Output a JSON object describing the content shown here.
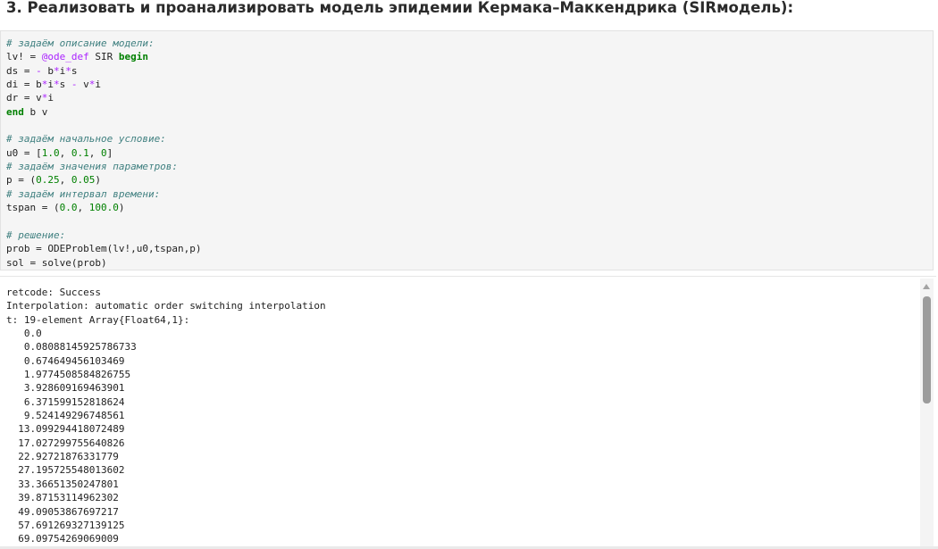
{
  "heading": "3. Реализовать и проанализировать модель эпидемии Кермака–Маккендрика (SIRмодель):",
  "code": {
    "comment_model": "# задаём описание модели:",
    "line_lv_pre": "lv! = ",
    "line_lv_macro": "@ode_def",
    "line_lv_mid": " SIR ",
    "line_lv_kw": "begin",
    "line_ds_pre": "ds = ",
    "line_ds_op1": "-",
    "line_ds_mid": " b",
    "line_ds_op2": "*",
    "line_ds_mid2": "i",
    "line_ds_op3": "*",
    "line_ds_end": "s",
    "line_di_pre": "di = b",
    "line_di_op1": "*",
    "line_di_mid": "i",
    "line_di_op2": "*",
    "line_di_mid2": "s ",
    "line_di_op3": "-",
    "line_di_mid3": " v",
    "line_di_op4": "*",
    "line_di_end": "i",
    "line_dr_pre": "dr = v",
    "line_dr_op": "*",
    "line_dr_end": "i",
    "line_end_kw": "end",
    "line_end_rest": " b v",
    "comment_initial": "# задаём начальное условие:",
    "line_u0_pre": "u0 = [",
    "line_u0_n1": "1.0",
    "line_u0_sep1": ", ",
    "line_u0_n2": "0.1",
    "line_u0_sep2": ", ",
    "line_u0_n3": "0",
    "line_u0_end": "]",
    "comment_params": "# задаём значения параметров:",
    "line_p_pre": "p = (",
    "line_p_n1": "0.25",
    "line_p_sep": ", ",
    "line_p_n2": "0.05",
    "line_p_end": ")",
    "comment_tspan": "# задаём интервал времени:",
    "line_tspan_pre": "tspan = (",
    "line_tspan_n1": "0.0",
    "line_tspan_sep": ", ",
    "line_tspan_n2": "100.0",
    "line_tspan_end": ")",
    "comment_solve": "# решение:",
    "line_prob": "prob = ODEProblem(lv!,u0,tspan,p)",
    "line_sol": "sol = solve(prob)"
  },
  "output": {
    "retcode": "retcode: Success",
    "interpolation": "Interpolation: automatic order switching interpolation",
    "t_header": "t: 19-element Array{Float64,1}:",
    "t_values": [
      "   0.0",
      "   0.08088145925786733",
      "   0.674649456103469",
      "   1.9774508584826755",
      "   3.928609169463901",
      "   6.371599152818624",
      "   9.524149296748561",
      "  13.099294418072489",
      "  17.027299755640826",
      "  22.92721876331779",
      "  27.195725548013602",
      "  33.36651350247801",
      "  39.87153114962302",
      "  49.09053867697217",
      "  57.691269327139125",
      "  69.09754269069009"
    ]
  },
  "scroll": {
    "position_fraction": 0.0,
    "visible_fraction": 0.4
  }
}
